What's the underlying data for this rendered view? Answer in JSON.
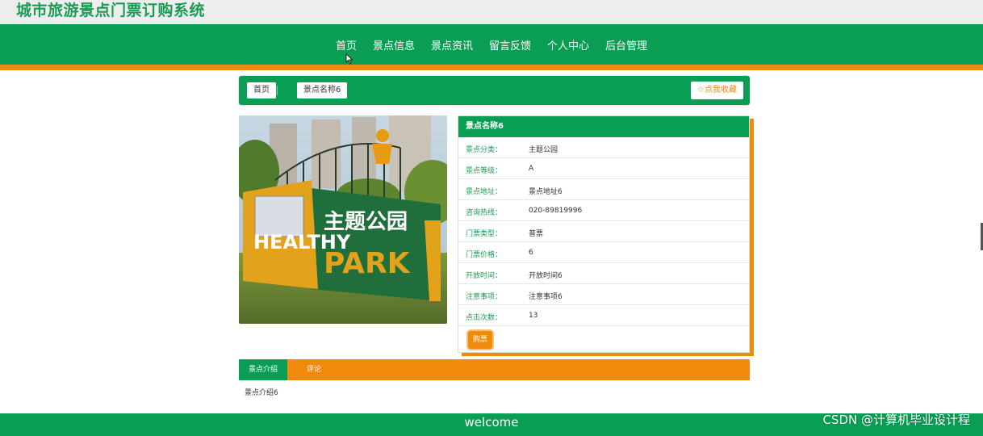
{
  "site": {
    "title": "城市旅游景点门票订购系统"
  },
  "nav": {
    "items": [
      "首页",
      "景点信息",
      "景点资讯",
      "留言反馈",
      "个人中心",
      "后台管理"
    ]
  },
  "breadcrumb": {
    "home": "首页",
    "current": "景点名称6",
    "favorite_label": "点我收藏",
    "favorite_icon": "star-outline-icon"
  },
  "photo": {
    "sign_text_top": "主题公园",
    "sign_text_left": "HEALTHY",
    "sign_text_right": "PARK"
  },
  "detail": {
    "title": "景点名称6",
    "rows": [
      {
        "label": "景点分类：",
        "value": "主题公园"
      },
      {
        "label": "景点等级：",
        "value": "A"
      },
      {
        "label": "景点地址：",
        "value": "景点地址6"
      },
      {
        "label": "咨询热线：",
        "value": "020-89819996"
      },
      {
        "label": "门票类型：",
        "value": "普票"
      },
      {
        "label": "门票价格：",
        "value": "6"
      },
      {
        "label": "开放时间：",
        "value": "开放时间6"
      },
      {
        "label": "注意事项：",
        "value": "注意事项6"
      },
      {
        "label": "点击次数：",
        "value": "13"
      }
    ],
    "buy_label": "购票"
  },
  "tabs": {
    "items": [
      "景点介绍",
      "评论"
    ],
    "active_content": "景点介绍6"
  },
  "footer": {
    "text": "welcome"
  },
  "watermark": "CSDN @计算机毕业设计程",
  "colors": {
    "primary_green": "#0a9e54",
    "accent_orange": "#ef8a0d"
  }
}
